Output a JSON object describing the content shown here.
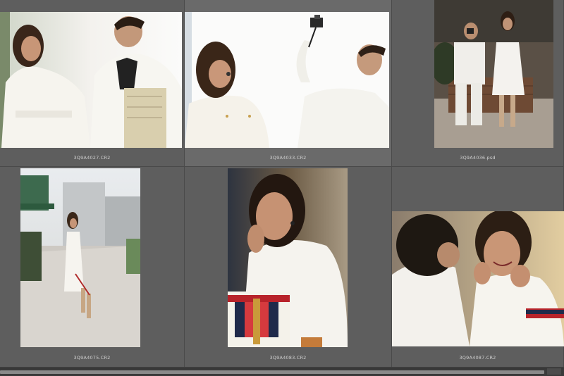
{
  "cells": [
    {
      "filename": "3Q9A4027.CR2",
      "photo": "couple-white-coats-newspaper"
    },
    {
      "filename": "3Q9A4033.CR2",
      "photo": "couple-camera-raised"
    },
    {
      "filename": "3Q9A4036.psd",
      "photo": "couple-street-standing"
    },
    {
      "filename": "3Q9A4075.CR2",
      "photo": "woman-walking-street"
    },
    {
      "filename": "3Q9A4083.CR2",
      "photo": "woman-portrait-handbag"
    },
    {
      "filename": "3Q9A4087.CR2",
      "photo": "woman-smiling-over-shoulder"
    }
  ],
  "colors": {
    "panel_bg": "#595959",
    "cell_bg": "#5e5e5e",
    "filename_text": "#d0d0d0",
    "scrollbar": "#8a8a8a"
  }
}
